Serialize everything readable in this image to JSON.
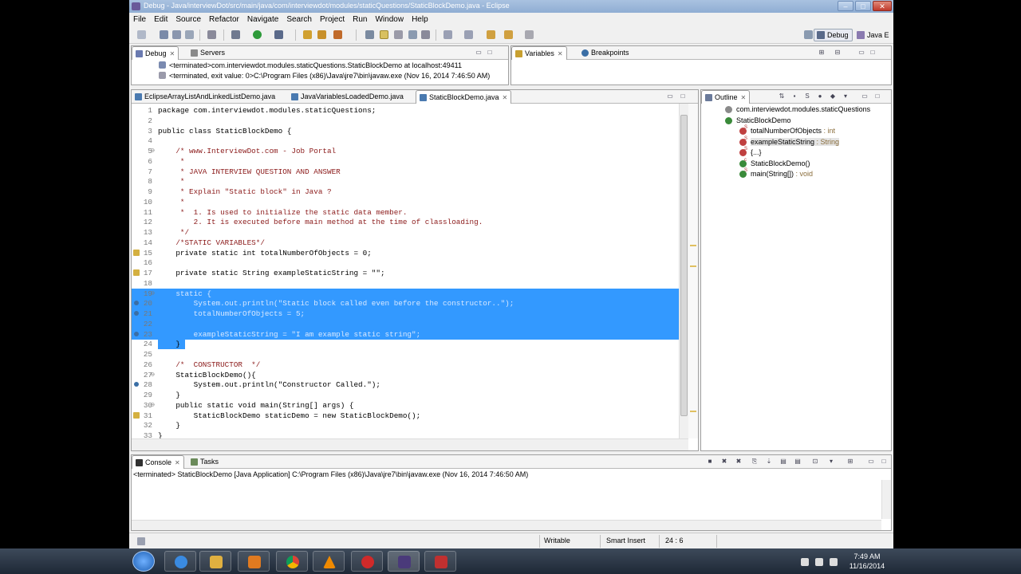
{
  "window": {
    "title": "Debug - Java/interviewDot/src/main/java/com/interviewdot/modules/staticQuestions/StaticBlockDemo.java - Eclipse",
    "controls": {
      "minimize": "–",
      "maximize": "□",
      "close": "✕"
    }
  },
  "menu": [
    "File",
    "Edit",
    "Source",
    "Refactor",
    "Navigate",
    "Search",
    "Project",
    "Run",
    "Window",
    "Help"
  ],
  "perspectives": {
    "debug": "Debug",
    "java": "Java E"
  },
  "debug_view": {
    "tabs": [
      {
        "label": "Debug",
        "active": true
      },
      {
        "label": "Servers",
        "active": false
      }
    ],
    "lines": [
      "<terminated>com.interviewdot.modules.staticQuestions.StaticBlockDemo at localhost:49411",
      "<terminated, exit value: 0>C:\\Program Files (x86)\\Java\\jre7\\bin\\javaw.exe (Nov 16, 2014 7:46:50 AM)"
    ]
  },
  "variables_view": {
    "tabs": [
      {
        "label": "Variables",
        "active": true
      },
      {
        "label": "Breakpoints",
        "active": false
      }
    ]
  },
  "editor": {
    "tabs": [
      {
        "label": "EclipseArrayListAndLinkedListDemo.java",
        "active": false
      },
      {
        "label": "JavaVariablesLoadedDemo.java",
        "active": false
      },
      {
        "label": "StaticBlockDemo.java",
        "active": true
      }
    ],
    "lines": [
      {
        "n": "1",
        "text": "package com.interviewdot.modules.staticQuestions;",
        "kind": "code"
      },
      {
        "n": "2",
        "text": "",
        "kind": "code"
      },
      {
        "n": "3",
        "text": "public class StaticBlockDemo {",
        "kind": "code"
      },
      {
        "n": "4",
        "text": "",
        "kind": "code"
      },
      {
        "n": "5",
        "text": "    /* www.InterviewDot.com - Job Portal",
        "kind": "comment",
        "fold": "⊖"
      },
      {
        "n": "6",
        "text": "     *",
        "kind": "comment"
      },
      {
        "n": "7",
        "text": "     * JAVA INTERVIEW QUESTION AND ANSWER",
        "kind": "comment"
      },
      {
        "n": "8",
        "text": "     *",
        "kind": "comment"
      },
      {
        "n": "9",
        "text": "     * Explain \"Static block\" in Java ?",
        "kind": "comment"
      },
      {
        "n": "10",
        "text": "     *",
        "kind": "comment"
      },
      {
        "n": "11",
        "text": "     *  1. Is used to initialize the static data member.",
        "kind": "comment"
      },
      {
        "n": "12",
        "text": "        2. It is executed before main method at the time of classloading.",
        "kind": "comment"
      },
      {
        "n": "13",
        "text": "     */",
        "kind": "comment"
      },
      {
        "n": "14",
        "text": "    /*STATIC VARIABLES*/",
        "kind": "comment"
      },
      {
        "n": "15",
        "text": "    private static int totalNumberOfObjects = 0;",
        "kind": "code",
        "marker": true
      },
      {
        "n": "16",
        "text": "",
        "kind": "code"
      },
      {
        "n": "17",
        "text": "    private static String exampleStaticString = \"\";",
        "kind": "code",
        "marker": true
      },
      {
        "n": "18",
        "text": "",
        "kind": "code"
      },
      {
        "n": "19",
        "text": "    static {",
        "kind": "selected",
        "fold": "⊖"
      },
      {
        "n": "20",
        "text": "        System.out.println(\"Static block called even before the constructor..\");",
        "kind": "selected",
        "bp": true
      },
      {
        "n": "21",
        "text": "        totalNumberOfObjects = 5;",
        "kind": "selected",
        "bp": true
      },
      {
        "n": "22",
        "text": "",
        "kind": "selected"
      },
      {
        "n": "23",
        "text": "        exampleStaticString = \"I am example static string\";",
        "kind": "selected",
        "bp": true
      },
      {
        "n": "24",
        "text": "    }",
        "kind": "selected-partial"
      },
      {
        "n": "25",
        "text": "",
        "kind": "code"
      },
      {
        "n": "26",
        "text": "    /*  CONSTRUCTOR  */",
        "kind": "comment"
      },
      {
        "n": "27",
        "text": "    StaticBlockDemo(){",
        "kind": "code",
        "fold": "⊖"
      },
      {
        "n": "28",
        "text": "        System.out.println(\"Constructor Called.\");",
        "kind": "code",
        "bp": true
      },
      {
        "n": "29",
        "text": "    }",
        "kind": "code"
      },
      {
        "n": "30",
        "text": "    public static void main(String[] args) {",
        "kind": "code",
        "fold": "⊖"
      },
      {
        "n": "31",
        "text": "        StaticBlockDemo staticDemo = new StaticBlockDemo();",
        "kind": "code",
        "marker": true
      },
      {
        "n": "32",
        "text": "    }",
        "kind": "code"
      },
      {
        "n": "33",
        "text": "}",
        "kind": "code"
      }
    ]
  },
  "outline": {
    "tab": "Outline",
    "items": [
      {
        "label": "com.interviewdot.modules.staticQuestions",
        "type": "",
        "color": "#8a8a8a"
      },
      {
        "label": "StaticBlockDemo",
        "type": "",
        "color": "#3a8a3a"
      },
      {
        "label": "totalNumberOfObjects",
        "type": " : int",
        "color": "#c04040",
        "mod": "S"
      },
      {
        "label": "exampleStaticString",
        "type": " : String",
        "color": "#c04040",
        "mod": "S"
      },
      {
        "label": "{...}",
        "type": "",
        "color": "#c04040",
        "mod": "S"
      },
      {
        "label": "StaticBlockDemo()",
        "type": "",
        "color": "#3a8a3a",
        "mod": "c"
      },
      {
        "label": "main(String[])",
        "type": " : void",
        "color": "#3a8a3a",
        "mod": "S"
      }
    ]
  },
  "console": {
    "tabs": [
      {
        "label": "Console",
        "active": true
      },
      {
        "label": "Tasks",
        "active": false
      }
    ],
    "header": "<terminated> StaticBlockDemo [Java Application] C:\\Program Files (x86)\\Java\\jre7\\bin\\javaw.exe (Nov 16, 2014 7:46:50 AM)"
  },
  "status": {
    "writable": "Writable",
    "insert_mode": "Smart Insert",
    "position": "24 : 6"
  },
  "clock": {
    "time": "7:49 AM",
    "date": "11/16/2014"
  },
  "colors": {
    "selection": "#3399ff",
    "comment": "#8b1a1a",
    "titlebar": "#9bb6da"
  }
}
